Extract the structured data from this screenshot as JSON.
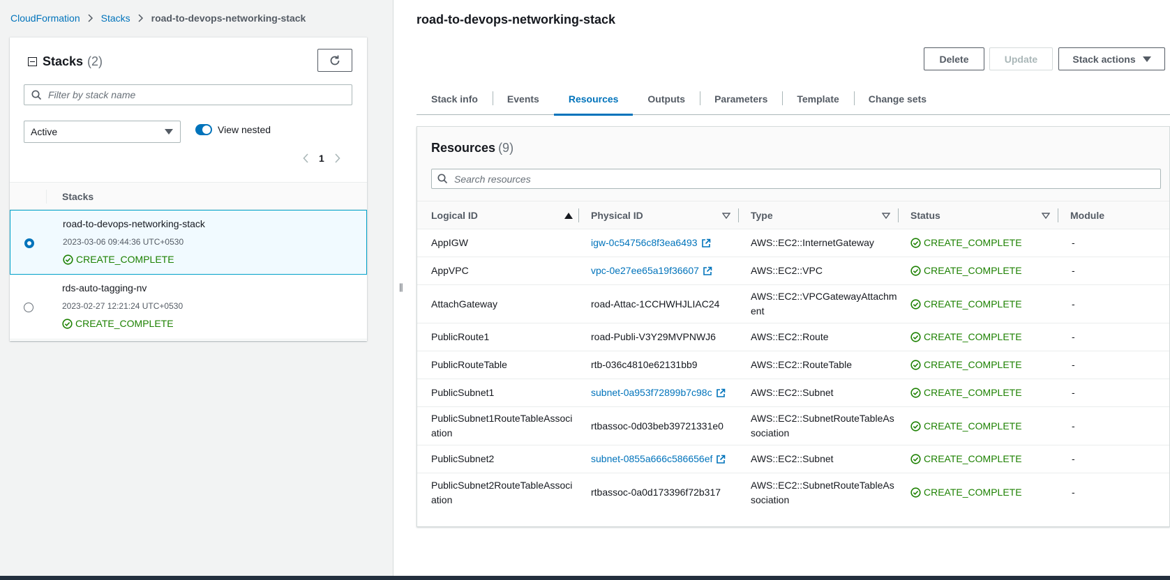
{
  "breadcrumb": {
    "items": [
      "CloudFormation",
      "Stacks"
    ],
    "current": "road-to-devops-networking-stack"
  },
  "stacks_panel": {
    "title": "Stacks",
    "count": "(2)",
    "filter_placeholder": "Filter by stack name",
    "status_filter": "Active",
    "view_nested_label": "View nested",
    "page": "1",
    "column_header": "Stacks",
    "rows": [
      {
        "name": "road-to-devops-networking-stack",
        "date": "2023-03-06 09:44:36 UTC+0530",
        "status": "CREATE_COMPLETE",
        "selected": true
      },
      {
        "name": "rds-auto-tagging-nv",
        "date": "2023-02-27 12:21:24 UTC+0530",
        "status": "CREATE_COMPLETE",
        "selected": false
      }
    ]
  },
  "detail": {
    "title": "road-to-devops-networking-stack",
    "buttons": {
      "delete": "Delete",
      "update": "Update",
      "stack_actions": "Stack actions"
    },
    "tabs": [
      "Stack info",
      "Events",
      "Resources",
      "Outputs",
      "Parameters",
      "Template",
      "Change sets"
    ],
    "active_tab": "Resources"
  },
  "resources": {
    "title": "Resources",
    "count": "(9)",
    "search_placeholder": "Search resources",
    "columns": [
      "Logical ID",
      "Physical ID",
      "Type",
      "Status",
      "Module"
    ],
    "rows": [
      {
        "logical": "AppIGW",
        "physical": "igw-0c54756c8f3ea6493",
        "link": true,
        "type": "AWS::EC2::InternetGateway",
        "status": "CREATE_COMPLETE",
        "module": "-"
      },
      {
        "logical": "AppVPC",
        "physical": "vpc-0e27ee65a19f36607",
        "link": true,
        "type": "AWS::EC2::VPC",
        "status": "CREATE_COMPLETE",
        "module": "-"
      },
      {
        "logical": "AttachGateway",
        "physical": "road-Attac-1CCHWHJLIAC24",
        "link": false,
        "type": "AWS::EC2::VPCGatewayAttachm\nent",
        "status": "CREATE_COMPLETE",
        "module": "-"
      },
      {
        "logical": "PublicRoute1",
        "physical": "road-Publi-V3Y29MVPNWJ6",
        "link": false,
        "type": "AWS::EC2::Route",
        "status": "CREATE_COMPLETE",
        "module": "-"
      },
      {
        "logical": "PublicRouteTable",
        "physical": "rtb-036c4810e62131bb9",
        "link": false,
        "type": "AWS::EC2::RouteTable",
        "status": "CREATE_COMPLETE",
        "module": "-"
      },
      {
        "logical": "PublicSubnet1",
        "physical": "subnet-0a953f72899b7c98c",
        "link": true,
        "type": "AWS::EC2::Subnet",
        "status": "CREATE_COMPLETE",
        "module": "-"
      },
      {
        "logical": "PublicSubnet1RouteTableAssoci\nation",
        "physical": "rtbassoc-0d03beb39721331e0",
        "link": false,
        "type": "AWS::EC2::SubnetRouteTableAs\nsociation",
        "status": "CREATE_COMPLETE",
        "module": "-"
      },
      {
        "logical": "PublicSubnet2",
        "physical": "subnet-0855a666c586656ef",
        "link": true,
        "type": "AWS::EC2::Subnet",
        "status": "CREATE_COMPLETE",
        "module": "-"
      },
      {
        "logical": "PublicSubnet2RouteTableAssoci\nation",
        "physical": "rtbassoc-0a0d173396f72b317",
        "link": false,
        "type": "AWS::EC2::SubnetRouteTableAs\nsociation",
        "status": "CREATE_COMPLETE",
        "module": "-"
      }
    ]
  },
  "colors": {
    "link": "#0073bb",
    "success": "#1d8102",
    "panel_bg": "#f2f3f3"
  }
}
